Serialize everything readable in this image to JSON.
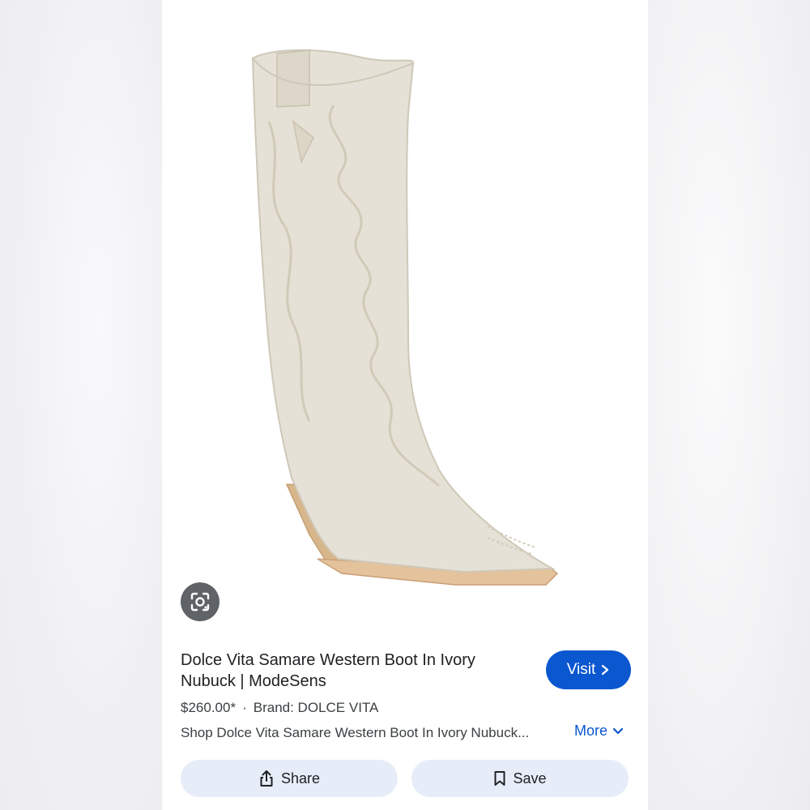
{
  "result": {
    "title": "Dolce Vita Samare Western Boot In Ivory Nubuck | ModeSens",
    "price": "$260.00*",
    "separator": "·",
    "brand": "Brand: DOLCE VITA",
    "description": "Shop Dolce Vita Samare Western Boot In Ivory Nubuck...",
    "more_label": "More",
    "visit_label": "Visit"
  },
  "actions": {
    "share_label": "Share",
    "save_label": "Save"
  },
  "icons": {
    "lens": "lens-icon",
    "visit_arrow": "chevron-right-icon",
    "more_arrow": "chevron-down-icon",
    "share": "share-icon",
    "save": "bookmark-icon"
  },
  "colors": {
    "accent": "#0b57d0",
    "action_bg": "#e7edf8",
    "boot": "#e6e1d6",
    "heel": "#d6b48a"
  }
}
